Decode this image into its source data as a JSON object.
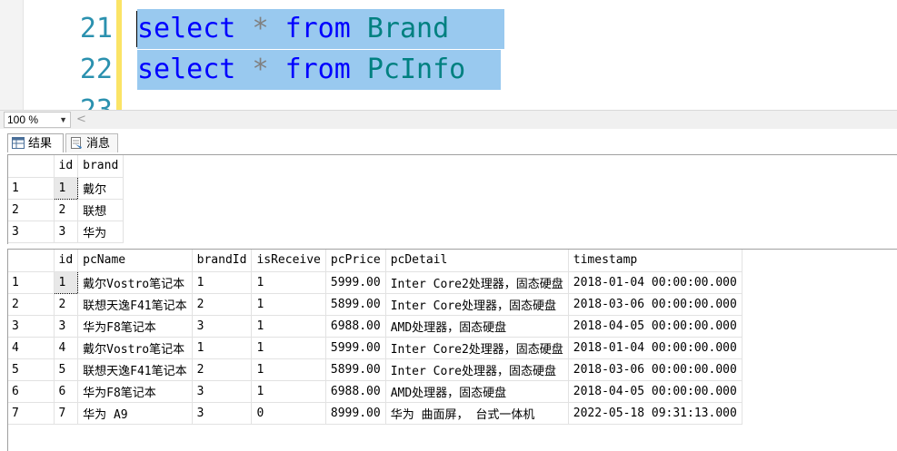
{
  "editor": {
    "lines": [
      {
        "number": "21",
        "keyword": "select",
        "star": "*",
        "from": "from",
        "table": "Brand"
      },
      {
        "number": "22",
        "keyword": "select",
        "star": "*",
        "from": "from",
        "table": "PcInfo"
      }
    ],
    "next_line_number": "23"
  },
  "zoom": {
    "value": "100 %"
  },
  "tabs": [
    {
      "label": "结果",
      "icon": "grid-icon"
    },
    {
      "label": "消息",
      "icon": "message-icon"
    }
  ],
  "results": [
    {
      "columns": [
        "id",
        "brand"
      ],
      "rows": [
        {
          "rownum": "1",
          "cells": [
            "1",
            "戴尔"
          ]
        },
        {
          "rownum": "2",
          "cells": [
            "2",
            "联想"
          ]
        },
        {
          "rownum": "3",
          "cells": [
            "3",
            "华为"
          ]
        }
      ]
    },
    {
      "columns": [
        "id",
        "pcName",
        "brandId",
        "isReceive",
        "pcPrice",
        "pcDetail",
        "timestamp"
      ],
      "rows": [
        {
          "rownum": "1",
          "cells": [
            "1",
            "戴尔Vostro笔记本",
            "1",
            "1",
            "5999.00",
            "Inter Core2处理器，固态硬盘",
            "2018-01-04 00:00:00.000"
          ]
        },
        {
          "rownum": "2",
          "cells": [
            "2",
            "联想天逸F41笔记本",
            "2",
            "1",
            "5899.00",
            "Inter Core处理器，固态硬盘",
            "2018-03-06 00:00:00.000"
          ]
        },
        {
          "rownum": "3",
          "cells": [
            "3",
            "华为F8笔记本",
            "3",
            "1",
            "6988.00",
            "AMD处理器，固态硬盘",
            "2018-04-05 00:00:00.000"
          ]
        },
        {
          "rownum": "4",
          "cells": [
            "4",
            "戴尔Vostro笔记本",
            "1",
            "1",
            "5999.00",
            "Inter Core2处理器，固态硬盘",
            "2018-01-04 00:00:00.000"
          ]
        },
        {
          "rownum": "5",
          "cells": [
            "5",
            "联想天逸F41笔记本",
            "2",
            "1",
            "5899.00",
            "Inter Core处理器，固态硬盘",
            "2018-03-06 00:00:00.000"
          ]
        },
        {
          "rownum": "6",
          "cells": [
            "6",
            "华为F8笔记本",
            "3",
            "1",
            "6988.00",
            "AMD处理器，固态硬盘",
            "2018-04-05 00:00:00.000"
          ]
        },
        {
          "rownum": "7",
          "cells": [
            "7",
            "华为 A9",
            "3",
            "0",
            "8999.00",
            "华为 曲面屏， 台式一体机",
            "2022-05-18 09:31:13.000"
          ]
        }
      ]
    }
  ],
  "colors": {
    "selection": "#99c9ef",
    "keyword": "#0000ff",
    "identifier": "#008080",
    "line_number": "#2b91af",
    "change_marker": "#fbe466"
  }
}
